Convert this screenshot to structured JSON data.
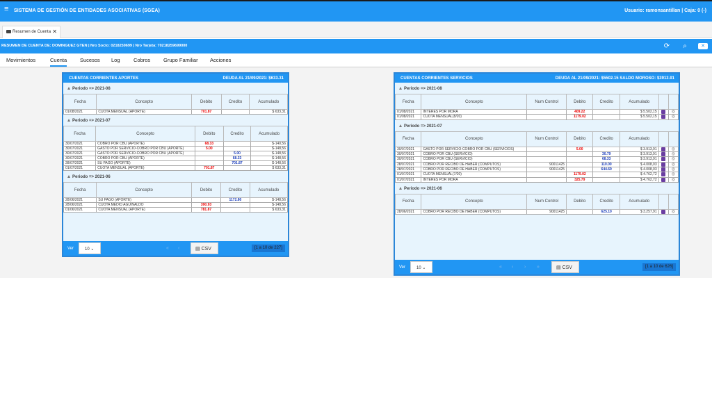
{
  "app": {
    "title": "SISTEMA DE GESTIÓN DE ENTIDADES ASOCIATIVAS (SGEA)",
    "user": "Usuario: ramonsantillan | Caja: 0 (-)"
  },
  "tab": {
    "label": "Resumen de Cuenta",
    "close": "✕"
  },
  "summary": "RESUMEN DE CUENTA DE: DOMINGUEZ GTEN | Nro Socio: 0218259699 | Nro Tarjeta: 70218259699000",
  "nav": [
    "Movimientos",
    "Cuenta",
    "Sucesos",
    "Log",
    "Cobros",
    "Grupo Familiar",
    "Acciones"
  ],
  "aportes": {
    "title": "CUENTAS CORRIENTES APORTES",
    "deuda": "DEUDA AL 21/09/2021: $633.31",
    "headers": [
      "Fecha",
      "Concepto",
      "Debito",
      "Credito",
      "Acumulado"
    ],
    "groups": [
      {
        "period": "Periodo => 2021-08",
        "rows": [
          [
            "01/08/2021",
            "CUOTA MENSUAL (APORTE)",
            "701.87",
            "",
            "$ 633,31"
          ]
        ]
      },
      {
        "period": "Periodo => 2021-07",
        "rows": [
          [
            "30/07/2021",
            "COBRO POR CBU (APORTE)",
            "68.33",
            "",
            "$-140,56"
          ],
          [
            "30/07/2021",
            "GASTO POR SERVICIO-COBRO POR CBU (APORTE)",
            "5.00",
            "",
            "$-148,56"
          ],
          [
            "30/07/2021",
            "GASTO POR SERVICIO-COBRO POR CBU (APORTE)",
            "",
            "5.00",
            "$-148,56"
          ],
          [
            "30/07/2021",
            "COBRO POR CBU (APORTE)",
            "",
            "68.33",
            "$-148,56"
          ],
          [
            "28/07/2021",
            "SU PAGO (APORTE)",
            "",
            "701.87",
            "$-148,56"
          ],
          [
            "01/07/2021",
            "CUOTA MENSUAL (APORTE)",
            "701.87",
            "",
            "$ 633,31"
          ]
        ]
      },
      {
        "period": "Periodo => 2021-06",
        "rows": [
          [
            "28/06/2021",
            "SU PAGO (APORTE)",
            "",
            "1172.80",
            "$-148,56"
          ],
          [
            "28/06/2021",
            "CUOTA MEDIO AGUINALDO",
            "390.93",
            "",
            "$-148,56"
          ],
          [
            "01/06/2021",
            "CUOTA MENSUAL (APORTE)",
            "781.87",
            "",
            "$ 633,31"
          ]
        ]
      }
    ],
    "footer": {
      "ver": "Ver",
      "page_size": "10",
      "csv": "CSV",
      "count": "[1 a 10 de 227]"
    }
  },
  "servicios": {
    "title": "CUENTAS CORRIENTES SERVICIOS",
    "deuda": "DEUDA AL 21/09/2021: $5502.15 SALDO MOROSO: $3913.91",
    "headers": [
      "Fecha",
      "Concepto",
      "Num Control",
      "Debito",
      "Credito",
      "Acumulado",
      "",
      ""
    ],
    "groups": [
      {
        "period": "Periodo => 2021-08",
        "rows": [
          [
            "01/08/2021",
            "INTERES POR MORA",
            "",
            "409.22",
            "",
            "$ 5.502,15"
          ],
          [
            "01/08/2021",
            "CUOTA MENSUAL(8/20)",
            "",
            "1179.02",
            "",
            "$ 5.502,15"
          ]
        ]
      },
      {
        "period": "Periodo => 2021-07",
        "rows": [
          [
            "30/07/2021",
            "GASTO POR SERVICIO-COBRO POR CBU (SERVICIOS)",
            "",
            "5.00",
            "",
            "$ 3.913,91"
          ],
          [
            "30/07/2021",
            "COBRO POR CBU (SERVICIO)",
            "",
            "",
            "30.79",
            "$ 3.913,91"
          ],
          [
            "30/07/2021",
            "COBRO POR CBU (SERVICIO)",
            "",
            "",
            "68.33",
            "$ 3.913,91"
          ],
          [
            "28/07/2021",
            "COBRO POR RECIBO DE HABER (COMPUTOS)",
            "90011425",
            "",
            "110.00",
            "$ 4.008,03"
          ],
          [
            "28/07/2021",
            "COBRO POR RECIBO DE HABER (COMPUTOS)",
            "90011425",
            "",
            "644.69",
            "$ 4.008,03"
          ],
          [
            "01/07/2021",
            "CUOTA MENSUAL(7/20)",
            "",
            "1179.02",
            "",
            "$ 4.762,72"
          ],
          [
            "01/07/2021",
            "INTERES POR MORA",
            "",
            "325.79",
            "",
            "$ 4.762,72"
          ]
        ]
      },
      {
        "period": "Periodo => 2021-06",
        "rows": [
          [
            "28/06/2021",
            "COBRO POR RECIBO DE HABER (COMPUTOS)",
            "90011425",
            "",
            "625.10",
            "$ 3.257,91"
          ]
        ]
      }
    ],
    "footer": {
      "ver": "Ver",
      "page_size": "10",
      "csv": "CSV",
      "count": "[1 a 10 de 626]"
    }
  },
  "colors": {
    "accent": "#2196f3",
    "debit": "#ee0000",
    "credit": "#1a3dbb"
  },
  "icons": [
    "menu-icon",
    "refresh-icon",
    "search-icon",
    "close-icon",
    "csv-file-icon",
    "document-icon",
    "view-icon"
  ]
}
